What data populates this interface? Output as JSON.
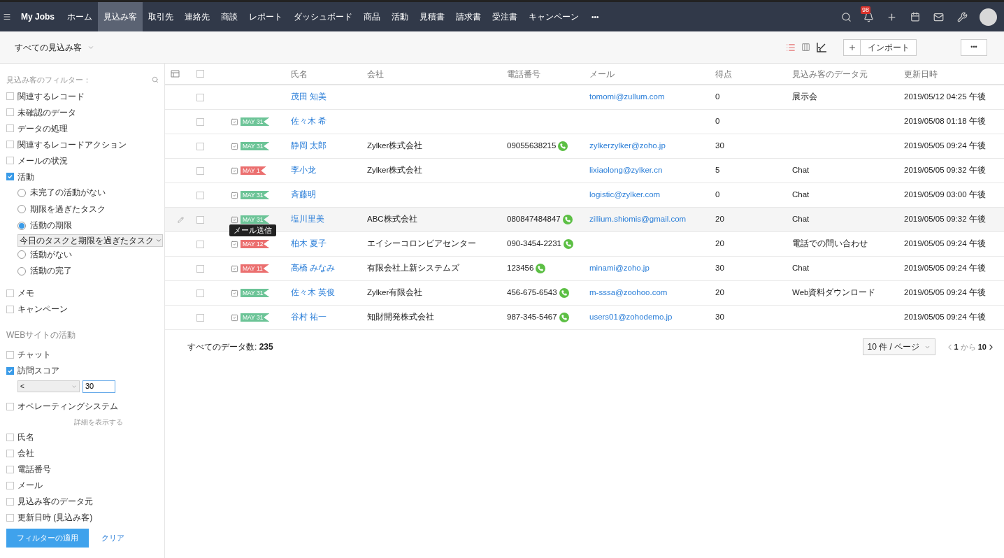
{
  "nav": {
    "brand": "My Jobs",
    "tabs": [
      {
        "label": "ホーム",
        "selected": false
      },
      {
        "label": "見込み客",
        "selected": true
      },
      {
        "label": "取引先",
        "selected": false
      },
      {
        "label": "連絡先",
        "selected": false
      },
      {
        "label": "商談",
        "selected": false
      },
      {
        "label": "レポート",
        "selected": false
      },
      {
        "label": "ダッシュボード",
        "selected": false
      },
      {
        "label": "商品",
        "selected": false
      },
      {
        "label": "活動",
        "selected": false
      },
      {
        "label": "見積書",
        "selected": false
      },
      {
        "label": "請求書",
        "selected": false
      },
      {
        "label": "受注書",
        "selected": false
      },
      {
        "label": "キャンペーン",
        "selected": false
      }
    ],
    "more": "•••",
    "notification_count": "98"
  },
  "toolbar": {
    "view_title": "すべての見込み客",
    "import_button": "インポート",
    "more_button": "•••"
  },
  "sidebar": {
    "filter_title": "見込み客のフィルター：",
    "filters": [
      {
        "kind": "checkbox",
        "label": "関連するレコード",
        "checked": false
      },
      {
        "kind": "checkbox",
        "label": "未確認のデータ",
        "checked": false
      },
      {
        "kind": "checkbox",
        "label": "データの処理",
        "checked": false
      },
      {
        "kind": "checkbox",
        "label": "関連するレコードアクション",
        "checked": false
      },
      {
        "kind": "checkbox",
        "label": "メールの状況",
        "checked": false
      },
      {
        "kind": "checkbox",
        "label": "活動",
        "checked": true,
        "options": [
          {
            "label": "未完了の活動がない",
            "selected": false
          },
          {
            "label": "期限を過ぎたタスク",
            "selected": false
          },
          {
            "label": "活動の期限",
            "selected": true,
            "dropdown": "今日のタスクと期限を過ぎたタスク"
          },
          {
            "label": "活動がない",
            "selected": false
          },
          {
            "label": "活動の完了",
            "selected": false
          }
        ]
      },
      {
        "kind": "checkbox",
        "label": "メモ",
        "checked": false
      },
      {
        "kind": "checkbox",
        "label": "キャンペーン",
        "checked": false
      },
      {
        "kind": "heading",
        "label": "WEBサイトの活動"
      },
      {
        "kind": "checkbox",
        "label": "チャット",
        "checked": false
      },
      {
        "kind": "checkbox",
        "label": "訪問スコア",
        "checked": true,
        "operator": "<",
        "value": "30"
      },
      {
        "kind": "checkbox",
        "label": "オペレーティングシステム",
        "checked": false
      },
      {
        "kind": "link",
        "label": "詳細を表示する"
      },
      {
        "kind": "checkbox",
        "label": "氏名",
        "checked": false
      },
      {
        "kind": "checkbox",
        "label": "会社",
        "checked": false
      },
      {
        "kind": "checkbox",
        "label": "電話番号",
        "checked": false
      },
      {
        "kind": "checkbox",
        "label": "メール",
        "checked": false
      },
      {
        "kind": "checkbox",
        "label": "見込み客のデータ元",
        "checked": false
      },
      {
        "kind": "checkbox",
        "label": "更新日時 (見込み客)",
        "checked": false
      }
    ],
    "apply_button": "フィルターの適用",
    "clear_link": "クリア"
  },
  "table": {
    "select_all_checked": false,
    "columns": [
      "氏名",
      "会社",
      "電話番号",
      "メール",
      "得点",
      "見込み客のデータ元",
      "更新日時"
    ],
    "rows": [
      {
        "hovered": false,
        "checked": false,
        "task": null,
        "name": "茂田 知美",
        "company": "",
        "phone": "",
        "email": "tomomi@zullum.com",
        "score": "0",
        "source": "展示会",
        "updated": "2019/05/12 04:25 午後"
      },
      {
        "hovered": false,
        "checked": false,
        "task": {
          "date": "MAY 31",
          "color": "#6cc497"
        },
        "name": "佐々木 希",
        "company": "",
        "phone": "",
        "email": "",
        "score": "0",
        "source": "",
        "updated": "2019/05/08 01:18 午後"
      },
      {
        "hovered": false,
        "checked": false,
        "task": {
          "date": "MAY 31",
          "color": "#6cc497"
        },
        "name": "静岡 太郎",
        "company": "Zylker株式会社",
        "phone": "09055638215",
        "email": "zylkerzylker@zoho.jp",
        "score": "30",
        "source": "",
        "updated": "2019/05/05 09:24 午後"
      },
      {
        "hovered": false,
        "checked": false,
        "task": {
          "date": "MAY 1",
          "color": "#eb6f6f"
        },
        "name": "李小龙",
        "company": "Zylker株式会社",
        "phone": "",
        "email": "lixiaolong@zylker.cn",
        "score": "5",
        "source": "Chat",
        "updated": "2019/05/05 09:32 午後"
      },
      {
        "hovered": false,
        "checked": false,
        "task": {
          "date": "MAY 31",
          "color": "#6cc497"
        },
        "name": "斉藤明",
        "company": "",
        "phone": "",
        "email": "logistic@zylker.com",
        "score": "0",
        "source": "Chat",
        "updated": "2019/05/09 03:00 午後"
      },
      {
        "hovered": true,
        "checked": false,
        "task": {
          "date": "MAY 31",
          "color": "#6cc497",
          "tooltip": "メール送信"
        },
        "name": "塩川里美",
        "company": "ABC株式会社",
        "phone": "080847484847",
        "email": "zillium.shiomis@gmail.com",
        "score": "20",
        "source": "Chat",
        "updated": "2019/05/05 09:32 午後"
      },
      {
        "hovered": false,
        "checked": false,
        "task": {
          "date": "MAY 12",
          "color": "#eb6f6f"
        },
        "name": "柏木 夏子",
        "company": "エイシーコロンビアセンター",
        "phone": "090-3454-2231",
        "email": "",
        "score": "20",
        "source": "電話での問い合わせ",
        "updated": "2019/05/05 09:24 午後"
      },
      {
        "hovered": false,
        "checked": false,
        "task": {
          "date": "MAY 11",
          "color": "#eb6f6f"
        },
        "name": "高橋 みなみ",
        "company": "有限会社上新システムズ",
        "phone": "123456",
        "email": "minami@zoho.jp",
        "score": "30",
        "source": "Chat",
        "updated": "2019/05/05 09:24 午後"
      },
      {
        "hovered": false,
        "checked": false,
        "task": {
          "date": "MAY 31",
          "color": "#6cc497"
        },
        "name": "佐々木 英俊",
        "company": "Zylker有限会社",
        "phone": "456-675-6543",
        "email": "m-sssa@zoohoo.com",
        "score": "20",
        "source": "Web資料ダウンロード",
        "updated": "2019/05/05 09:24 午後"
      },
      {
        "hovered": false,
        "checked": false,
        "task": {
          "date": "MAY 31",
          "color": "#6cc497"
        },
        "name": "谷村 祐一",
        "company": "知財開発株式会社",
        "phone": "987-345-5467",
        "email": "users01@zohodemo.jp",
        "score": "30",
        "source": "",
        "updated": "2019/05/05 09:24 午後"
      }
    ]
  },
  "footer": {
    "total_label": "すべてのデータ数:",
    "total": "235",
    "page_size": "10 件 / ページ",
    "range_start": "1",
    "range_word": "から",
    "range_end": "10"
  }
}
